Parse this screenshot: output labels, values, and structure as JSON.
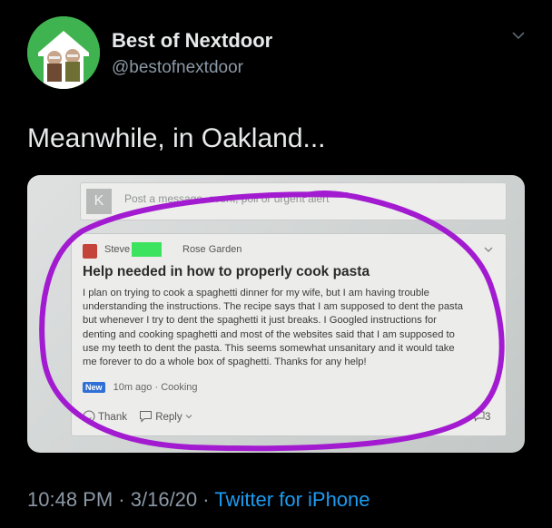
{
  "tweet": {
    "display_name": "Best of Nextdoor",
    "handle": "@bestofnextdoor",
    "text": "Meanwhile, in Oakland...",
    "time": "10:48 PM",
    "date": "3/16/20",
    "separator": "·",
    "source": "Twitter for iPhone"
  },
  "photo": {
    "composer": {
      "avatar_letter": "K",
      "placeholder": "Post a message, event, poll or urgent alert"
    },
    "post": {
      "author": "Steve",
      "neighborhood": "Rose Garden",
      "title": "Help needed in how to properly cook pasta",
      "body_lines": [
        "I plan on trying to cook a spaghetti dinner for my wife, but I am having trouble",
        "understanding the instructions. The recipe says that I am supposed to dent the pasta",
        "but whenever I try to dent the spaghetti it just breaks. I Googled instructions for",
        "denting and cooking spaghetti and most of the websites said that I am supposed to",
        "use my teeth to dent the pasta. This seems somewhat unsanitary and it would take",
        "me forever to do a whole box of spaghetti. Thanks for any help!"
      ],
      "badge": "New",
      "time_ago": "10m ago",
      "meta_separator": "·",
      "category": "Cooking",
      "thank_label": "Thank",
      "reply_label": "Reply",
      "reply_count": "3"
    }
  },
  "colors": {
    "background": "#000000",
    "avatar_green": "#3fb34f",
    "link_blue": "#1d9bf0",
    "muted_text": "#8b98a5",
    "circle_purple": "#a21bd0",
    "redaction_green": "#3ce35e"
  }
}
